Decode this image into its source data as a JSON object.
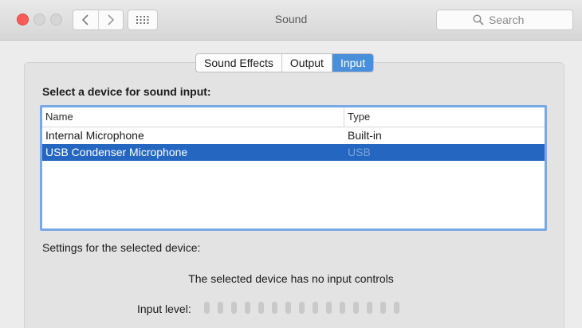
{
  "window": {
    "title": "Sound",
    "search_placeholder": "Search"
  },
  "tabs": [
    {
      "label": "Sound Effects",
      "active": false
    },
    {
      "label": "Output",
      "active": false
    },
    {
      "label": "Input",
      "active": true
    }
  ],
  "input": {
    "heading": "Select a device for sound input:",
    "columns": {
      "name": "Name",
      "type": "Type"
    },
    "devices": [
      {
        "name": "Internal Microphone",
        "type": "Built-in",
        "selected": false
      },
      {
        "name": "USB Condenser Microphone",
        "type": "USB",
        "selected": true
      }
    ],
    "settings_label": "Settings for the selected device:",
    "no_controls_text": "The selected device has no input controls",
    "input_level_label": "Input level:",
    "input_level_segments": 15,
    "input_level_value": 0
  },
  "colors": {
    "accent": "#4a8fd9",
    "selection": "#2466c0",
    "close_button": "#fc5b57"
  }
}
